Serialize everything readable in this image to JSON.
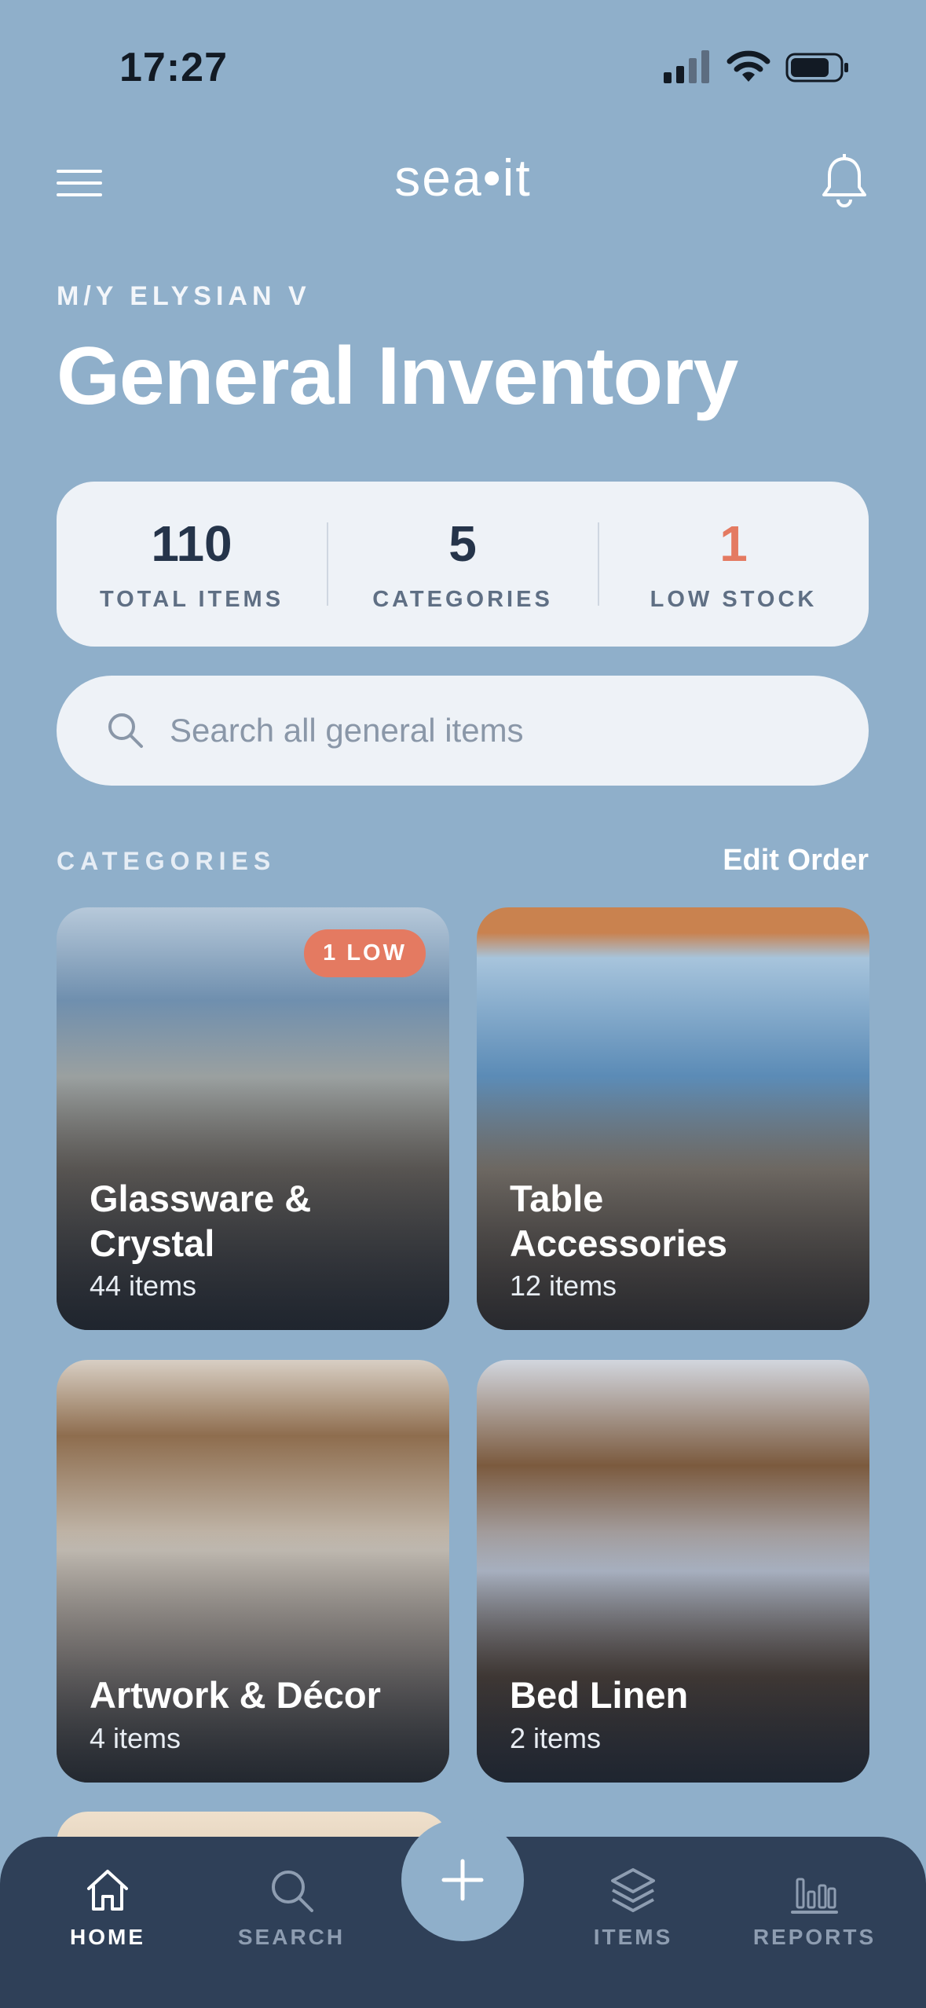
{
  "status_bar": {
    "time": "17:27"
  },
  "header": {
    "logo": "sea•it"
  },
  "vessel_name": "M/Y ELYSIAN V",
  "page_title": "General Inventory",
  "stats": [
    {
      "value": "110",
      "label": "TOTAL ITEMS"
    },
    {
      "value": "5",
      "label": "CATEGORIES"
    },
    {
      "value": "1",
      "label": "LOW STOCK"
    }
  ],
  "search": {
    "placeholder": "Search all general items",
    "value": ""
  },
  "categories_section": {
    "label": "CATEGORIES",
    "edit_label": "Edit Order"
  },
  "categories": [
    {
      "name": "Glassware & Crystal",
      "count": "44 items",
      "badge": "1 LOW"
    },
    {
      "name": "Table Accessories",
      "count": "12 items"
    },
    {
      "name": "Artwork & Décor",
      "count": "4 items"
    },
    {
      "name": "Bed Linen",
      "count": "2 items"
    }
  ],
  "bottom_nav": [
    {
      "label": "HOME",
      "icon": "home-icon",
      "active": true
    },
    {
      "label": "SEARCH",
      "icon": "search-icon"
    },
    {
      "label": "ITEMS",
      "icon": "layers-icon"
    },
    {
      "label": "REPORTS",
      "icon": "bar-chart-icon"
    }
  ],
  "colors": {
    "background": "#8fafca",
    "card": "#eef2f7",
    "accent_low": "#e47a61",
    "nav": "#2f4058",
    "text_dark": "#25344a"
  }
}
